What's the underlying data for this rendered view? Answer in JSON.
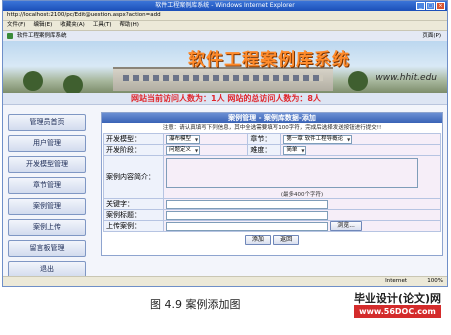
{
  "window": {
    "title": "软件工程案例库系统 - Windows Internet Explorer"
  },
  "address": {
    "url": "http://localhost:2100/pc/Edit@uestion.aspx?action=add"
  },
  "menu": {
    "items": [
      "文件(F)",
      "编辑(E)",
      "收藏夹(A)",
      "工具(T)",
      "帮助(H)"
    ]
  },
  "tab": {
    "title": "软件工程案例库系统",
    "page_label": "页面(P)"
  },
  "banner": {
    "title": "软件工程案例库系统",
    "url": "www.hhit.edu"
  },
  "marquee": {
    "text": "网站当前访问人数为：1人  网站的总访问人数为：8人"
  },
  "sidebar": {
    "items": [
      "管理员首页",
      "用户管理",
      "开发模型管理",
      "章节管理",
      "案例管理",
      "案例上传",
      "留言板管理",
      "退出"
    ]
  },
  "panel": {
    "header": "案例管理 - 案例库数据-添加",
    "notice": "注意：请认真填写下列信息，其中全选需要填写100字符，完成后选择发送按钮进行提交!!",
    "model_label": "开发模型：",
    "model_value": "瀑布模型",
    "chapter_label": "章节：",
    "chapter_value": "第一章 软件工程导概论",
    "stage_label": "开发阶段：",
    "stage_value": "问题定义",
    "difficulty_label": "难度：",
    "difficulty_value": "简单",
    "intro_label": "案例内容简介：",
    "intro_hint": "(最多400个字符)",
    "keyword_label": "关键字：",
    "title_label": "案例标题：",
    "upload_label": "上传案例：",
    "browse_label": "浏览...",
    "add_label": "添加",
    "back_label": "返回"
  },
  "status": {
    "zone": "Internet",
    "zoom": "100%"
  },
  "caption": {
    "text": "图 4.9   案例添加图"
  },
  "watermark": {
    "line1": "毕业设计(论文)网",
    "line2": "www.56DOC.com"
  }
}
